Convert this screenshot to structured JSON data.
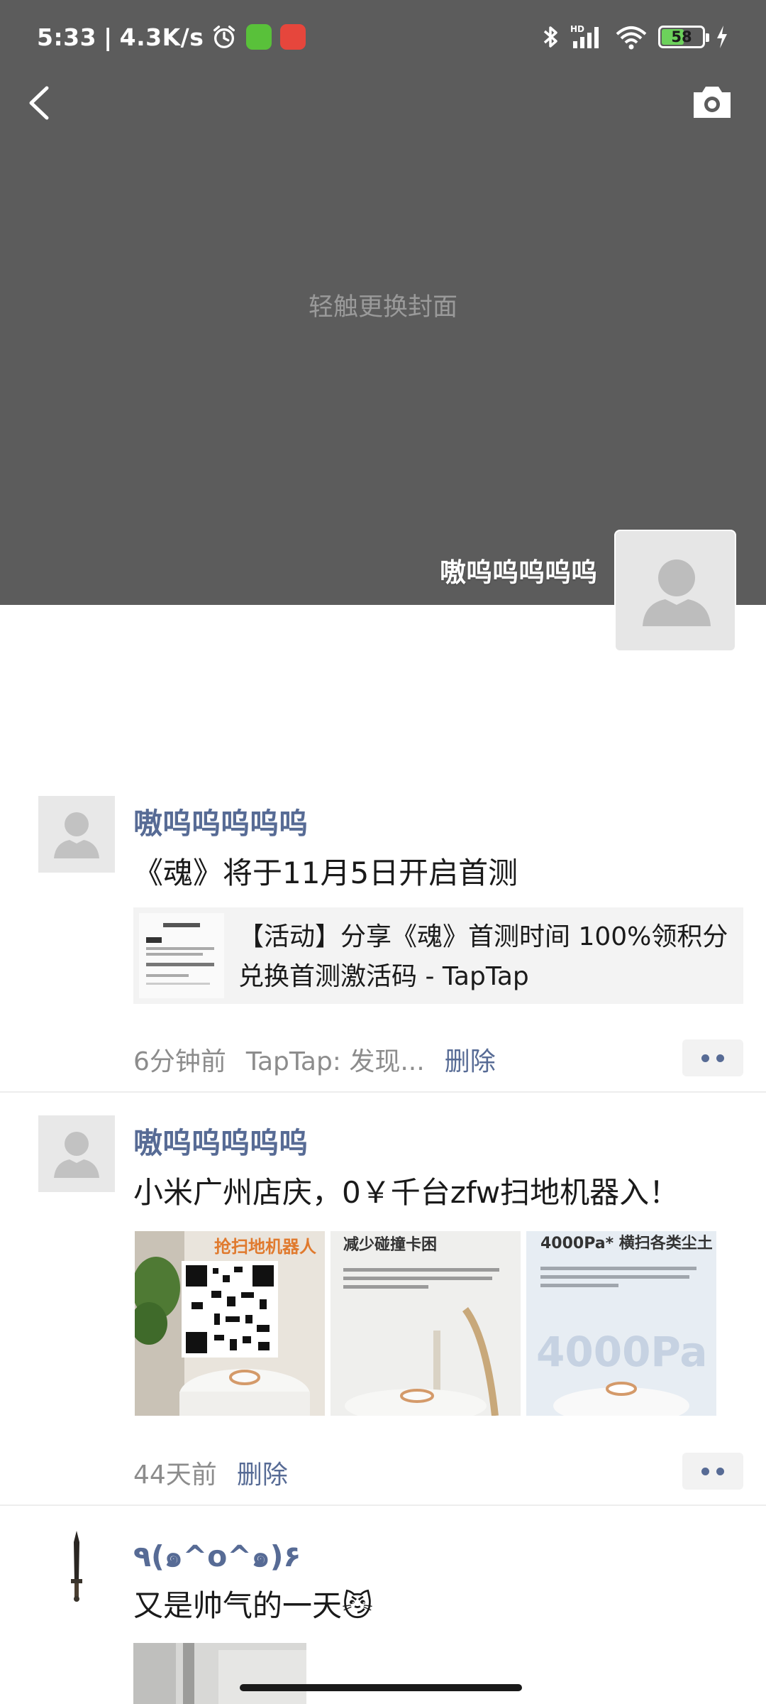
{
  "status_bar": {
    "time": "5:33",
    "separator": "|",
    "net_speed": "4.3K/s",
    "battery": "58",
    "battery_level": 0.58,
    "icons": [
      "alarm-icon",
      "app-badge-green",
      "app-badge-red",
      "bluetooth-icon",
      "cellular-signal-icon",
      "wifi-icon",
      "battery-icon",
      "charging-icon"
    ]
  },
  "header": {
    "back_icon": "chevron-left-icon",
    "camera_icon": "camera-icon",
    "cover_hint": "轻触更换封面",
    "user_name": "嗷呜呜呜呜呜"
  },
  "posts": [
    {
      "author": "嗷呜呜呜呜呜",
      "text": "《魂》将于11月5日开启首测",
      "link_title": "【活动】分享《魂》首测时间 100%领积分兑换首测激活码 - TapTap",
      "time": "6分钟前",
      "source": "TapTap: 发现...",
      "delete_label": "删除"
    },
    {
      "author": "嗷呜呜呜呜呜",
      "text": "小米广州店庆，0￥千台zfw扫地机器入！",
      "photos": [
        {
          "caption": "抢扫地机器人"
        },
        {
          "caption": "减少碰撞卡困"
        },
        {
          "caption": "4000Pa* 横扫各类尘土",
          "watermark": "4000Pa"
        }
      ],
      "time": "44天前",
      "delete_label": "删除"
    },
    {
      "author": "٩(๑^o^๑)۶",
      "text": "又是帅气的一天😼"
    }
  ],
  "colors": {
    "cover_bg": "#5c5c5c",
    "name_blue": "#576b95",
    "meta_gray": "#8c8c8c"
  }
}
